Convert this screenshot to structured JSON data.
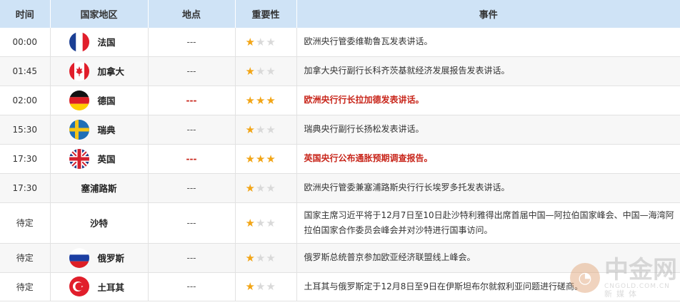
{
  "headers": {
    "time": "时间",
    "country": "国家地区",
    "location": "地点",
    "importance": "重要性",
    "event": "事件"
  },
  "rows": [
    {
      "time": "00:00",
      "country": "法国",
      "flag": "france",
      "location": "---",
      "stars": 1,
      "event": "欧洲央行管委维勒鲁瓦发表讲话。",
      "highlight": false
    },
    {
      "time": "01:45",
      "country": "加拿大",
      "flag": "canada",
      "location": "---",
      "stars": 1,
      "event": "加拿大央行副行长科齐茨基就经济发展报告发表讲话。",
      "highlight": false
    },
    {
      "time": "02:00",
      "country": "德国",
      "flag": "germany",
      "location": "---",
      "stars": 3,
      "event": "欧洲央行行长拉加德发表讲话。",
      "highlight": true
    },
    {
      "time": "15:30",
      "country": "瑞典",
      "flag": "sweden",
      "location": "---",
      "stars": 1,
      "event": "瑞典央行副行长扬松发表讲话。",
      "highlight": false
    },
    {
      "time": "17:30",
      "country": "英国",
      "flag": "uk",
      "location": "---",
      "stars": 3,
      "event": "英国央行公布通胀预期调查报告。",
      "highlight": true
    },
    {
      "time": "17:30",
      "country": "塞浦路斯",
      "flag": "",
      "location": "---",
      "stars": 1,
      "event": "欧洲央行管委兼塞浦路斯央行行长埃罗多托发表讲话。",
      "highlight": false
    },
    {
      "time": "待定",
      "country": "沙特",
      "flag": "",
      "location": "---",
      "stars": 1,
      "event": "国家主席习近平将于12月7日至10日赴沙特利雅得出席首届中国—阿拉伯国家峰会、中国—海湾阿拉伯国家合作委员会峰会并对沙特进行国事访问。",
      "highlight": false
    },
    {
      "time": "待定",
      "country": "俄罗斯",
      "flag": "russia",
      "location": "---",
      "stars": 1,
      "event": "俄罗斯总统普京参加欧亚经济联盟线上峰会。",
      "highlight": false
    },
    {
      "time": "待定",
      "country": "土耳其",
      "flag": "turkey",
      "location": "---",
      "stars": 1,
      "event": "土耳其与俄罗斯定于12月8日至9日在伊斯坦布尔就叙利亚问题进行磋商。",
      "highlight": false
    }
  ],
  "watermark": {
    "name": "中金网",
    "url": "CNGOLD.COM.CN",
    "tagline": "新媒体"
  },
  "colors": {
    "header_bg": "#cfe3f6",
    "highlight": "#c8261b",
    "star_on": "#f2a516",
    "star_off": "#d9d9d9"
  }
}
